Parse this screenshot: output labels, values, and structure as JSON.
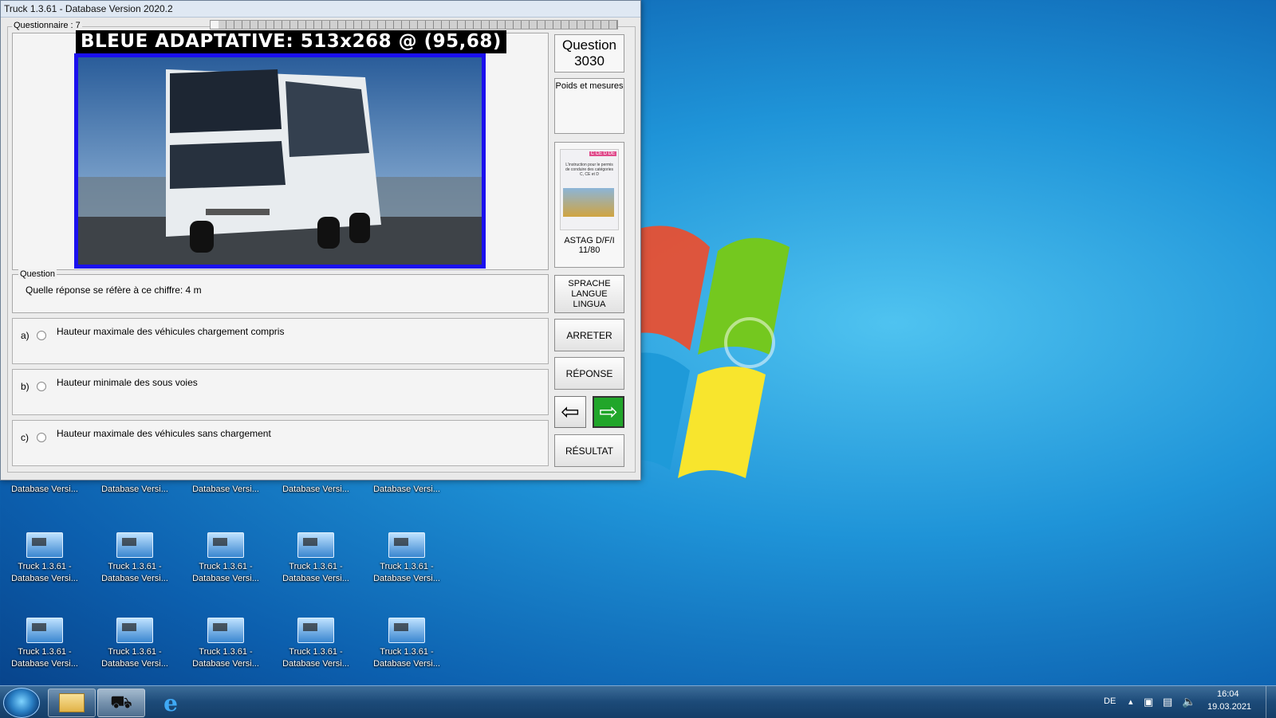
{
  "window": {
    "title": "Truck 1.3.61 - Database Version 2020.2",
    "questionnaire_label": "Questionnaire : 7",
    "progress_fraction": 0.02
  },
  "image_overlay": {
    "label": "BLEUE ADAPTATIVE: 513x268 @ (95,68)"
  },
  "sidebar": {
    "question_title": "Question",
    "question_number": "3030",
    "category": "Poids et mesures",
    "book_cover_text": "L'instruction pour le permis de conduire des catégories C, CE et D",
    "book_badges": "C CE D DE",
    "book_label": "ASTAG D/F/I",
    "book_page": "11/80",
    "language_button": [
      "SPRACHE",
      "LANGUE",
      "LINGUA"
    ],
    "stop_button": "ARRETER",
    "answer_button": "RÉPONSE",
    "result_button": "RÉSULTAT"
  },
  "question": {
    "caption": "Question",
    "text": "Quelle réponse se réfère à ce chiffre: 4 m"
  },
  "answers": [
    {
      "letter": "a)",
      "text": "Hauteur maximale des véhicules chargement compris"
    },
    {
      "letter": "b)",
      "text": "Hauteur minimale des sous voies"
    },
    {
      "letter": "c)",
      "text": "Hauteur maximale des véhicules sans chargement"
    }
  ],
  "desktop": {
    "icon_line1": "Truck 1.3.61 -",
    "icon_line2": "Database Versi..."
  },
  "taskbar": {
    "language": "DE",
    "time": "16:04",
    "date": "19.03.2021"
  },
  "colors": {
    "highlight_border": "#1a10ee",
    "next_button": "#21a62a"
  }
}
